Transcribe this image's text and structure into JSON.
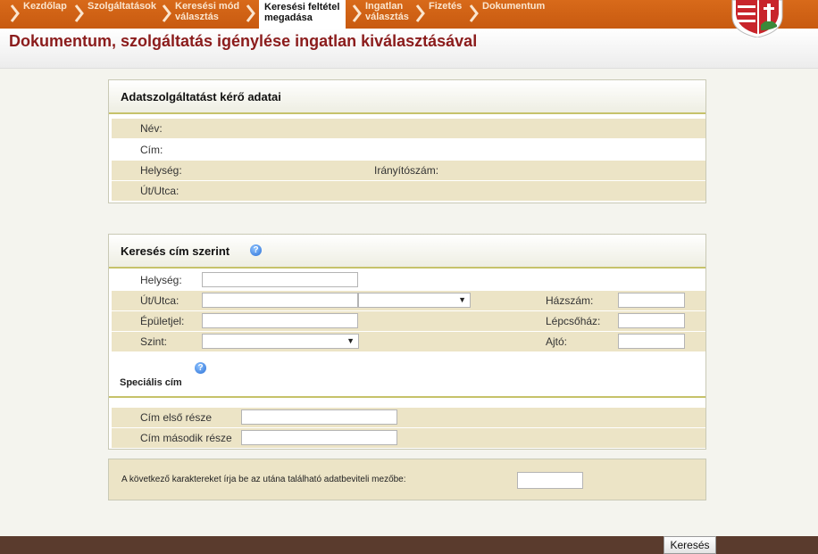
{
  "nav": {
    "crumbs": [
      {
        "label_1": "Kezdőlap",
        "label_2": ""
      },
      {
        "label_1": "Szolgáltatások",
        "label_2": ""
      },
      {
        "label_1": "Keresési mód",
        "label_2": "választás"
      },
      {
        "label_1": "Keresési feltétel",
        "label_2": "megadása"
      },
      {
        "label_1": "Ingatlan",
        "label_2": "választás"
      },
      {
        "label_1": "Fizetés",
        "label_2": ""
      },
      {
        "label_1": "Dokumentum",
        "label_2": ""
      }
    ],
    "active_index": 3
  },
  "page_title": "Dokumentum, szolgáltatás igénylése ingatlan kiválasztásával",
  "requester": {
    "title": "Adatszolgáltatást kérő adatai",
    "name_label": "Név:",
    "address_label": "Cím:",
    "city_label": "Helység:",
    "zip_label": "Irányítószám:",
    "street_label": "Út/Utca:"
  },
  "search": {
    "title": "Keresés cím szerint",
    "city_label": "Helység:",
    "street_label": "Út/Utca:",
    "house_number_label": "Házszám:",
    "building_label": "Épületjel:",
    "staircase_label": "Lépcsőház:",
    "level_label": "Szint:",
    "door_label": "Ajtó:",
    "special_title": "Speciális cím",
    "special_first_label": "Cím első része",
    "special_second_label": "Cím második része",
    "help_symbol": "?"
  },
  "captcha": {
    "instruction": "A következő karaktereket írja be az utána található adatbeviteli mezőbe:"
  },
  "actions": {
    "search_button": "Keresés"
  },
  "colors": {
    "nav_orange": "#d86a1a",
    "title_red": "#8b1c1c",
    "row_beige": "#ece4c6",
    "footer_brown": "#5a3b2d"
  }
}
